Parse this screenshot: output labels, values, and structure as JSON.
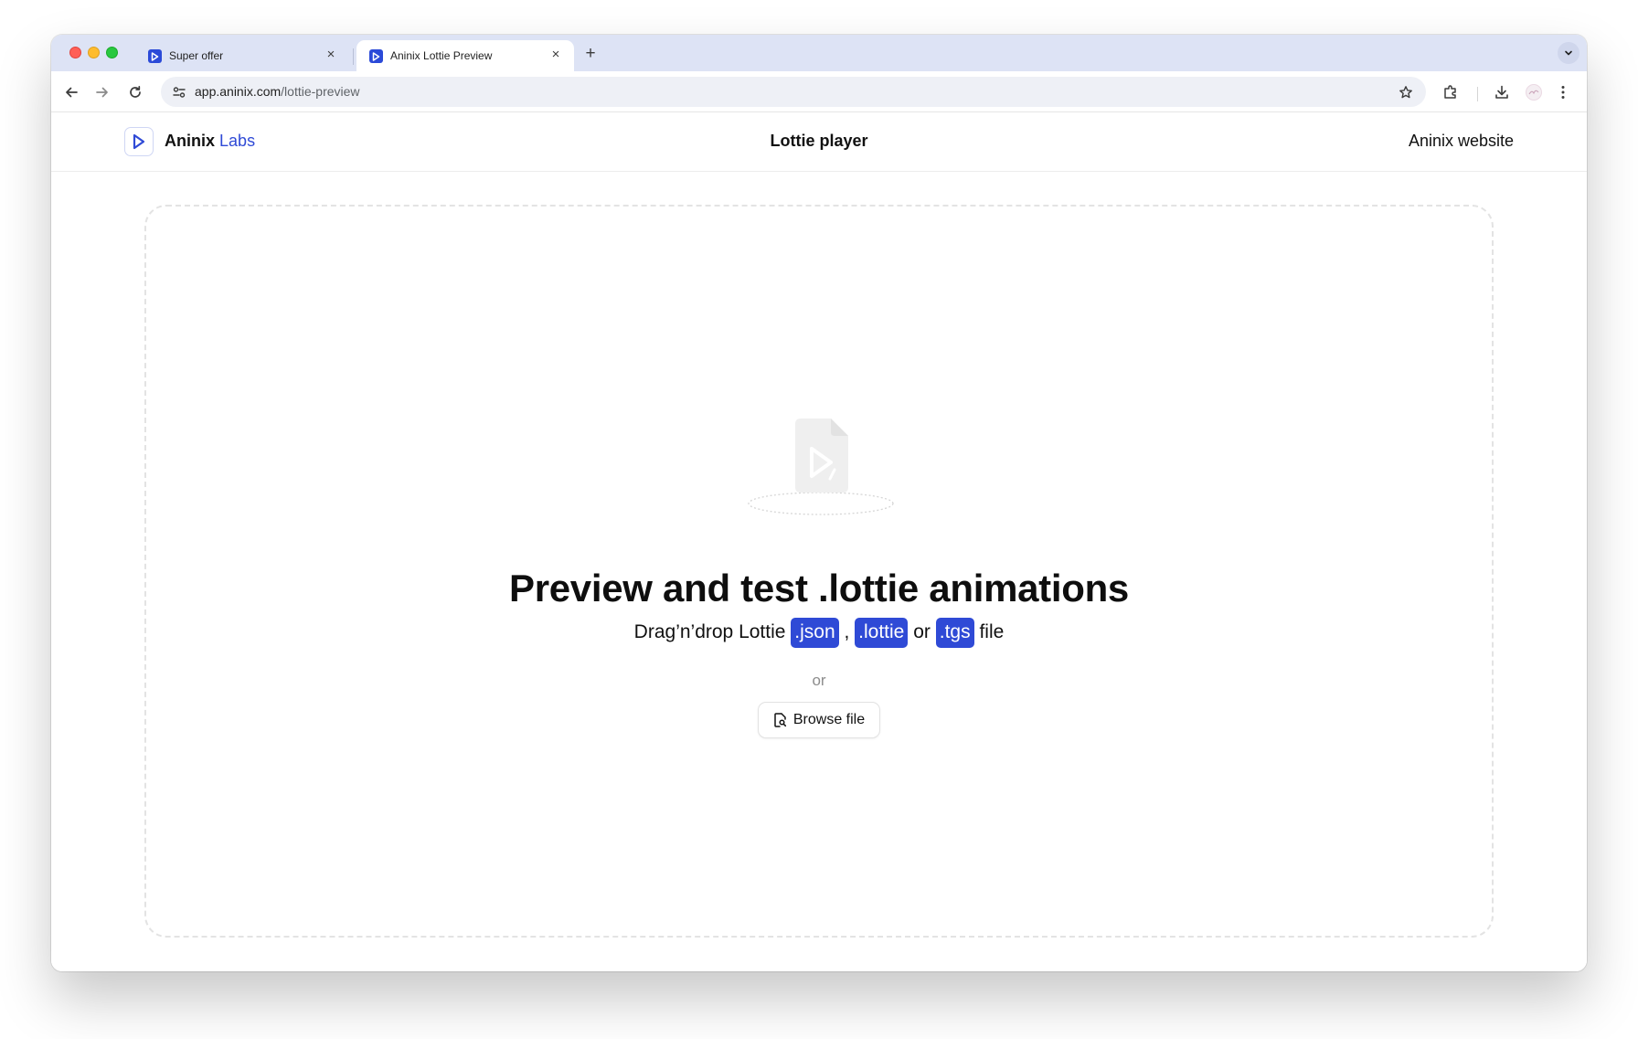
{
  "browser": {
    "tabs": [
      {
        "title": "Super offer",
        "active": false
      },
      {
        "title": "Aninix Lottie Preview",
        "active": true
      }
    ],
    "new_tab_label": "+",
    "close_label": "×",
    "url_host": "app.aninix.com",
    "url_path": "/lottie-preview"
  },
  "header": {
    "brand_name": "Aninix",
    "brand_suffix": "Labs",
    "center_title": "Lottie player",
    "right_link": "Aninix website"
  },
  "dropzone": {
    "headline": "Preview and test .lottie animations",
    "sub_prefix": "Drag’n’drop Lottie",
    "formats": [
      ".json",
      ".lottie",
      ".tgs"
    ],
    "sep_comma": ",",
    "sep_or": "or",
    "sub_suffix": "file",
    "or_label": "or",
    "browse_label": "Browse file"
  },
  "colors": {
    "accent": "#2f4ad6",
    "tabstrip": "#dde3f5",
    "omnibox": "#eef0f6"
  },
  "icons": [
    "back-arrow-icon",
    "forward-arrow-icon",
    "reload-icon",
    "site-info-icon",
    "star-icon",
    "extensions-icon",
    "download-icon",
    "profile-icon",
    "kebab-menu-icon",
    "chevron-down-icon",
    "file-play-icon",
    "file-search-icon",
    "play-logo-icon"
  ]
}
